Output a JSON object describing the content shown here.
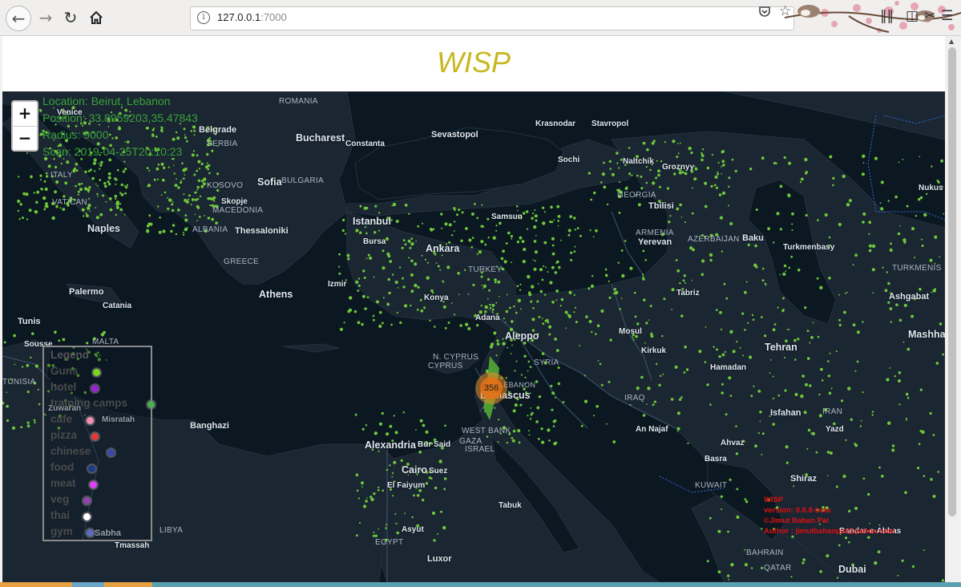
{
  "browser": {
    "url_host": "127.0.0.1",
    "url_port": ":7000"
  },
  "page": {
    "title": "WISP"
  },
  "map": {
    "zoom_in_label": "+",
    "zoom_out_label": "−",
    "info": {
      "location": "Location: Beirut, Lebanon",
      "position": "Position: 33.8959203,35.47843",
      "radius": "Radius: 9000",
      "scan": "Scan: 2019-04-25T20:10:23"
    },
    "cluster_count": "356",
    "legend": {
      "title": "Legend",
      "items": [
        {
          "label": "Guns",
          "color": "#7ed321"
        },
        {
          "label": "hotel",
          "color": "#9b1fd8"
        },
        {
          "label": "training camps",
          "color": "#4caf50"
        },
        {
          "label": "cafe",
          "color": "#f48fb1"
        },
        {
          "label": "pizza",
          "color": "#e53935"
        },
        {
          "label": "chinese",
          "color": "#3949ab"
        },
        {
          "label": "food",
          "color": "#1e3a8a"
        },
        {
          "label": "meat",
          "color": "#e040fb"
        },
        {
          "label": "veg",
          "color": "#8e44ad"
        },
        {
          "label": "thai",
          "color": "#ffffff"
        },
        {
          "label": "gym",
          "color": "#5c6bc0"
        }
      ]
    },
    "credits": {
      "line1": "WISP",
      "line2": "version: 0.0.8-beta",
      "line3": "©Jimut Bahan Pal",
      "line4": "Author : jimutbahanpal@yahoo.com"
    },
    "cities": [
      {
        "name": "Venice"
      },
      {
        "name": "Belgrade"
      },
      {
        "name": "Bucharest"
      },
      {
        "name": "Constanta"
      },
      {
        "name": "Sevastopol"
      },
      {
        "name": "Krasnodar"
      },
      {
        "name": "Stavropol"
      },
      {
        "name": "Sochi"
      },
      {
        "name": "Naltchik"
      },
      {
        "name": "Groznyy"
      },
      {
        "name": "Nukus"
      },
      {
        "name": "Sofia"
      },
      {
        "name": "Skopje"
      },
      {
        "name": "Tbilisi"
      },
      {
        "name": "Istanbul"
      },
      {
        "name": "Samsun"
      },
      {
        "name": "Bursa"
      },
      {
        "name": "Ankara"
      },
      {
        "name": "Yerevan"
      },
      {
        "name": "Baku"
      },
      {
        "name": "Turkmenbasy"
      },
      {
        "name": "Naples"
      },
      {
        "name": "Thessaloniki"
      },
      {
        "name": "Ashgabat"
      },
      {
        "name": "Izmir"
      },
      {
        "name": "Palermo"
      },
      {
        "name": "Catania"
      },
      {
        "name": "Athens"
      },
      {
        "name": "Konya"
      },
      {
        "name": "Tabriz"
      },
      {
        "name": "Adana"
      },
      {
        "name": "Tunis"
      },
      {
        "name": "Sousse"
      },
      {
        "name": "Aleppo"
      },
      {
        "name": "Mosul"
      },
      {
        "name": "Kirkuk"
      },
      {
        "name": "Mashha"
      },
      {
        "name": "Tehran"
      },
      {
        "name": "Hamadan"
      },
      {
        "name": "Damascus"
      },
      {
        "name": "Zuwaran"
      },
      {
        "name": "Misratah"
      },
      {
        "name": "Isfahan"
      },
      {
        "name": "Banghazi"
      },
      {
        "name": "An Najaf"
      },
      {
        "name": "Yazd"
      },
      {
        "name": "Alexandria"
      },
      {
        "name": "Bur Said"
      },
      {
        "name": "Ahvaz"
      },
      {
        "name": "Cairo"
      },
      {
        "name": "Suez"
      },
      {
        "name": "Basra"
      },
      {
        "name": "El Faiyum"
      },
      {
        "name": "Shiraz"
      },
      {
        "name": "Tabuk"
      },
      {
        "name": "Asyut"
      },
      {
        "name": "Sabha"
      },
      {
        "name": "Bandar-e-Abbas"
      },
      {
        "name": "Tmassah"
      },
      {
        "name": "Luxor"
      },
      {
        "name": "Dubai"
      }
    ],
    "countries": [
      {
        "name": "ROMANIA"
      },
      {
        "name": "SERBIA"
      },
      {
        "name": "BULGARIA"
      },
      {
        "name": "KOSOVO"
      },
      {
        "name": "ITALY"
      },
      {
        "name": "VATICAN"
      },
      {
        "name": "MACEDONIA"
      },
      {
        "name": "GEORGIA"
      },
      {
        "name": "ALBANIA"
      },
      {
        "name": "ARMENIA"
      },
      {
        "name": "AZERBAIJAN"
      },
      {
        "name": "GREECE"
      },
      {
        "name": "TURKEY"
      },
      {
        "name": "TURKMENIS"
      },
      {
        "name": "MALTA"
      },
      {
        "name": "N. CYPRUS"
      },
      {
        "name": "CYPRUS"
      },
      {
        "name": "SYRIA"
      },
      {
        "name": "TUNISIA"
      },
      {
        "name": "LEBANON"
      },
      {
        "name": "IRAQ"
      },
      {
        "name": "IRAN"
      },
      {
        "name": "WEST BANK"
      },
      {
        "name": "GAZA"
      },
      {
        "name": "ISRAEL"
      },
      {
        "name": "KUWAIT"
      },
      {
        "name": "LIBYA"
      },
      {
        "name": "EGYPT"
      },
      {
        "name": "BAHRAIN"
      },
      {
        "name": "QATAR"
      }
    ]
  }
}
